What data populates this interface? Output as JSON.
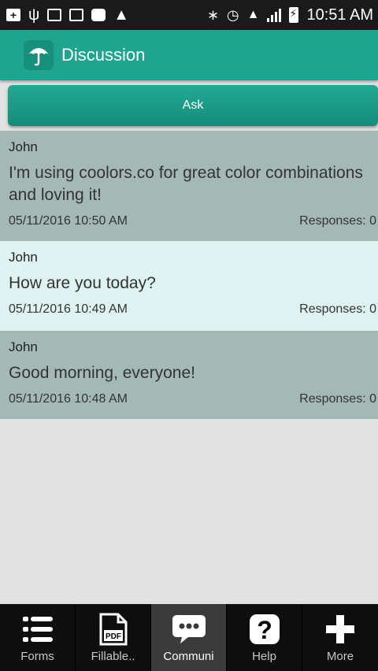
{
  "status_bar": {
    "time": "10:51 AM",
    "icons": [
      "add-box-icon",
      "usb-icon",
      "sms-icon",
      "image-icon",
      "security-icon",
      "warning-icon",
      "bluetooth-icon",
      "alarm-icon",
      "wifi-icon",
      "signal-icon",
      "battery-charging-icon"
    ]
  },
  "action_bar": {
    "title": "Discussion",
    "icon": "umbrella-icon",
    "color": "#1fa58f"
  },
  "ask_button": {
    "label": "Ask"
  },
  "posts": [
    {
      "author": "John",
      "message": "I'm using coolors.co for great color combinations and loving it!",
      "timestamp": "05/11/2016 10:50 AM",
      "responses": "Responses: 0",
      "background": "#a4b8b6"
    },
    {
      "author": "John",
      "message": "How are you today?",
      "timestamp": "05/11/2016 10:49 AM",
      "responses": "Responses: 0",
      "background": "#dff3f3"
    },
    {
      "author": "John",
      "message": "Good morning, everyone!",
      "timestamp": "05/11/2016 10:48 AM",
      "responses": "Responses: 0",
      "background": "#a4b8b6"
    }
  ],
  "bottom_nav": {
    "items": [
      {
        "label": "Forms",
        "icon": "list-icon",
        "active": false
      },
      {
        "label": "Fillable..",
        "icon": "pdf-icon",
        "active": false
      },
      {
        "label": "Communi",
        "icon": "chat-bubble-icon",
        "active": true
      },
      {
        "label": "Help",
        "icon": "question-icon",
        "active": false
      },
      {
        "label": "More",
        "icon": "plus-icon",
        "active": false
      }
    ]
  }
}
